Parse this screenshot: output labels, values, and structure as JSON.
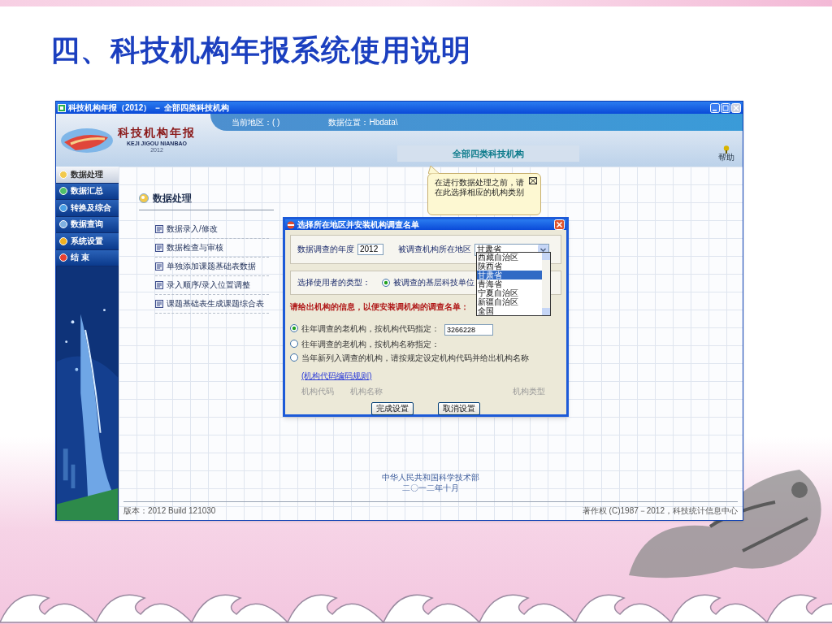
{
  "slide": {
    "title": "四、科技机构年报系统使用说明"
  },
  "window": {
    "title": "科技机构年报（2012） － 全部四类科技机构"
  },
  "header": {
    "logo_title": "科技机构年报",
    "logo_subtitle": "KEJI JIGOU NIANBAO",
    "logo_year": "2012",
    "current_region": "当前地区：( )",
    "data_location": "数据位置：Hbdata\\",
    "banner": "全部四类科技机构",
    "help": "帮助"
  },
  "sidebar": {
    "items": [
      {
        "label": "数据处理",
        "selected": true
      },
      {
        "label": "数据汇总",
        "selected": false
      },
      {
        "label": "转换及综合",
        "selected": false
      },
      {
        "label": "数据查询",
        "selected": false
      },
      {
        "label": "系统设置",
        "selected": false
      },
      {
        "label": "结 束",
        "selected": false
      }
    ]
  },
  "tooltip": {
    "text": "在进行数据处理之前，请在此选择相应的机构类别"
  },
  "main": {
    "heading": "数据处理",
    "items": [
      "数据录入/修改",
      "数据检查与审核",
      "单独添加课题基础表数据",
      "录入顺序/录入位置调整",
      "课题基础表生成课题综合表"
    ]
  },
  "dialog": {
    "title": "选择所在地区并安装机构调查名单",
    "year_label": "数据调查的年度",
    "year_value": "2012",
    "region_label": "被调查机构所在地区",
    "region_value": "甘肃省",
    "region_options": [
      {
        "label": "西藏自治区",
        "selected": false
      },
      {
        "label": "陕西省",
        "selected": false
      },
      {
        "label": "甘肃省",
        "selected": true
      },
      {
        "label": "青海省",
        "selected": false
      },
      {
        "label": "宁夏自治区",
        "selected": false
      },
      {
        "label": "新疆自治区",
        "selected": false
      },
      {
        "label": "全国",
        "selected": false
      }
    ],
    "user_type_label": "选择使用者的类型：",
    "user_types": [
      {
        "label": "被调查的基层科技单位",
        "selected": true
      }
    ],
    "instruction": "请给出机构的信息，以便安装调机构的调查名单：",
    "options": [
      {
        "label": "往年调查的老机构，按机构代码指定：",
        "selected": true,
        "value": "3266228"
      },
      {
        "label": "往年调查的老机构，按机构名称指定：",
        "selected": false
      },
      {
        "label": "当年新列入调查的机构，请按规定设定机构代码并给出机构名称",
        "selected": false,
        "link": "(机构代码编码规则)"
      }
    ],
    "columns": [
      "机构代码",
      "机构名称",
      "机构类型"
    ],
    "buttons": [
      "完成设置",
      "取消设置"
    ]
  },
  "footer": {
    "organization": "中华人民共和国科学技术部",
    "date": "二〇一二年十月",
    "version": "版本：2012 Build 121030",
    "copyright": "著作权 (C)1987－2012，科技统计信息中心"
  }
}
